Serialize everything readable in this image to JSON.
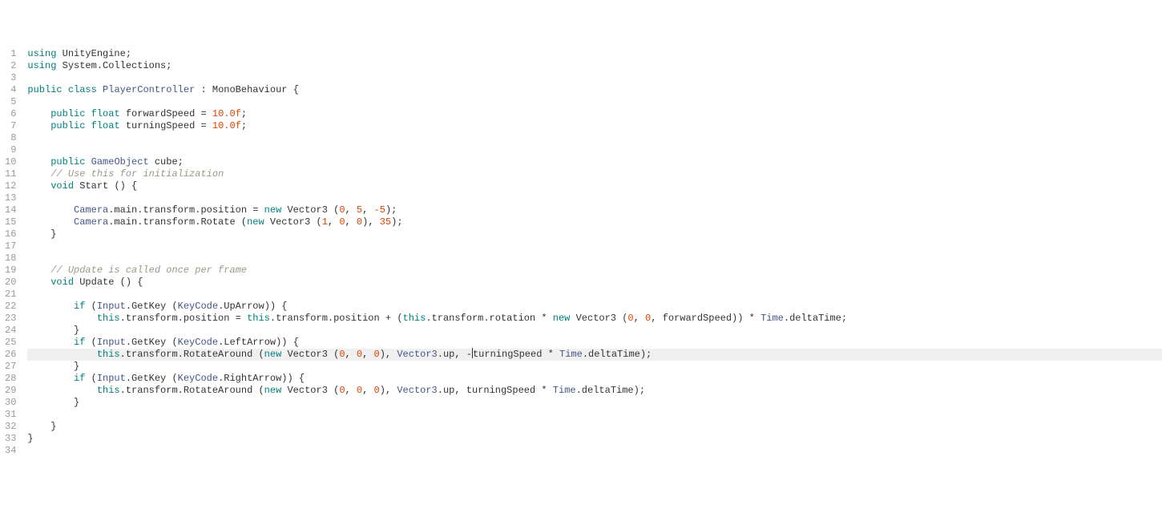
{
  "highlighted_line": 26,
  "lines": [
    {
      "n": 1,
      "tokens": [
        {
          "t": "using",
          "c": "kw"
        },
        {
          "t": " "
        },
        {
          "t": "UnityEngine",
          "c": "ident"
        },
        {
          "t": ";",
          "c": "punct"
        }
      ]
    },
    {
      "n": 2,
      "tokens": [
        {
          "t": "using",
          "c": "kw"
        },
        {
          "t": " "
        },
        {
          "t": "System.Collections",
          "c": "ident"
        },
        {
          "t": ";",
          "c": "punct"
        }
      ]
    },
    {
      "n": 3,
      "tokens": []
    },
    {
      "n": 4,
      "tokens": [
        {
          "t": "public",
          "c": "kw"
        },
        {
          "t": " "
        },
        {
          "t": "class",
          "c": "kw"
        },
        {
          "t": " "
        },
        {
          "t": "PlayerController",
          "c": "classname"
        },
        {
          "t": " : "
        },
        {
          "t": "MonoBehaviour",
          "c": "ident"
        },
        {
          "t": " {",
          "c": "punct"
        }
      ]
    },
    {
      "n": 5,
      "tokens": []
    },
    {
      "n": 6,
      "tokens": [
        {
          "t": "    "
        },
        {
          "t": "public",
          "c": "kw"
        },
        {
          "t": " "
        },
        {
          "t": "float",
          "c": "type"
        },
        {
          "t": " "
        },
        {
          "t": "forwardSpeed",
          "c": "ident"
        },
        {
          "t": " = "
        },
        {
          "t": "10.0f",
          "c": "num"
        },
        {
          "t": ";",
          "c": "punct"
        }
      ]
    },
    {
      "n": 7,
      "tokens": [
        {
          "t": "    "
        },
        {
          "t": "public",
          "c": "kw"
        },
        {
          "t": " "
        },
        {
          "t": "float",
          "c": "type"
        },
        {
          "t": " "
        },
        {
          "t": "turningSpeed",
          "c": "ident"
        },
        {
          "t": " = "
        },
        {
          "t": "10.0f",
          "c": "num"
        },
        {
          "t": ";",
          "c": "punct"
        }
      ]
    },
    {
      "n": 8,
      "tokens": []
    },
    {
      "n": 9,
      "tokens": []
    },
    {
      "n": 10,
      "tokens": [
        {
          "t": "    "
        },
        {
          "t": "public",
          "c": "kw"
        },
        {
          "t": " "
        },
        {
          "t": "GameObject",
          "c": "classname"
        },
        {
          "t": " "
        },
        {
          "t": "cube",
          "c": "ident"
        },
        {
          "t": ";",
          "c": "punct"
        }
      ]
    },
    {
      "n": 11,
      "tokens": [
        {
          "t": "    "
        },
        {
          "t": "// Use this for initialization",
          "c": "comment"
        }
      ]
    },
    {
      "n": 12,
      "tokens": [
        {
          "t": "    "
        },
        {
          "t": "void",
          "c": "type"
        },
        {
          "t": " "
        },
        {
          "t": "Start",
          "c": "ident"
        },
        {
          "t": " () {",
          "c": "punct"
        }
      ]
    },
    {
      "n": 13,
      "tokens": []
    },
    {
      "n": 14,
      "tokens": [
        {
          "t": "        "
        },
        {
          "t": "Camera",
          "c": "classname"
        },
        {
          "t": ".main.transform.position = "
        },
        {
          "t": "new",
          "c": "kw"
        },
        {
          "t": " "
        },
        {
          "t": "Vector3",
          "c": "ident"
        },
        {
          "t": " ("
        },
        {
          "t": "0",
          "c": "num"
        },
        {
          "t": ", "
        },
        {
          "t": "5",
          "c": "num"
        },
        {
          "t": ", "
        },
        {
          "t": "-5",
          "c": "num"
        },
        {
          "t": ");",
          "c": "punct"
        }
      ]
    },
    {
      "n": 15,
      "tokens": [
        {
          "t": "        "
        },
        {
          "t": "Camera",
          "c": "classname"
        },
        {
          "t": ".main.transform.Rotate ("
        },
        {
          "t": "new",
          "c": "kw"
        },
        {
          "t": " "
        },
        {
          "t": "Vector3",
          "c": "ident"
        },
        {
          "t": " ("
        },
        {
          "t": "1",
          "c": "num"
        },
        {
          "t": ", "
        },
        {
          "t": "0",
          "c": "num"
        },
        {
          "t": ", "
        },
        {
          "t": "0",
          "c": "num"
        },
        {
          "t": "), "
        },
        {
          "t": "35",
          "c": "num"
        },
        {
          "t": ");",
          "c": "punct"
        }
      ]
    },
    {
      "n": 16,
      "tokens": [
        {
          "t": "    }",
          "c": "punct"
        }
      ]
    },
    {
      "n": 17,
      "tokens": []
    },
    {
      "n": 18,
      "tokens": []
    },
    {
      "n": 19,
      "tokens": [
        {
          "t": "    "
        },
        {
          "t": "// Update is called once per frame",
          "c": "comment"
        }
      ]
    },
    {
      "n": 20,
      "tokens": [
        {
          "t": "    "
        },
        {
          "t": "void",
          "c": "type"
        },
        {
          "t": " "
        },
        {
          "t": "Update",
          "c": "ident"
        },
        {
          "t": " () {",
          "c": "punct"
        }
      ]
    },
    {
      "n": 21,
      "tokens": []
    },
    {
      "n": 22,
      "tokens": [
        {
          "t": "        "
        },
        {
          "t": "if",
          "c": "kw"
        },
        {
          "t": " ("
        },
        {
          "t": "Input",
          "c": "classname"
        },
        {
          "t": ".GetKey ("
        },
        {
          "t": "KeyCode",
          "c": "classname"
        },
        {
          "t": ".UpArrow)) {",
          "c": "punct"
        }
      ]
    },
    {
      "n": 23,
      "tokens": [
        {
          "t": "            "
        },
        {
          "t": "this",
          "c": "kw"
        },
        {
          "t": ".transform.position = "
        },
        {
          "t": "this",
          "c": "kw"
        },
        {
          "t": ".transform.position + ("
        },
        {
          "t": "this",
          "c": "kw"
        },
        {
          "t": ".transform.rotation * "
        },
        {
          "t": "new",
          "c": "kw"
        },
        {
          "t": " "
        },
        {
          "t": "Vector3",
          "c": "ident"
        },
        {
          "t": " ("
        },
        {
          "t": "0",
          "c": "num"
        },
        {
          "t": ", "
        },
        {
          "t": "0",
          "c": "num"
        },
        {
          "t": ", forwardSpeed)) * "
        },
        {
          "t": "Time",
          "c": "classname"
        },
        {
          "t": ".deltaTime;",
          "c": "punct"
        }
      ]
    },
    {
      "n": 24,
      "tokens": [
        {
          "t": "        }",
          "c": "punct"
        }
      ]
    },
    {
      "n": 25,
      "tokens": [
        {
          "t": "        "
        },
        {
          "t": "if",
          "c": "kw"
        },
        {
          "t": " ("
        },
        {
          "t": "Input",
          "c": "classname"
        },
        {
          "t": ".GetKey ("
        },
        {
          "t": "KeyCode",
          "c": "classname"
        },
        {
          "t": ".LeftArrow)) {",
          "c": "punct"
        }
      ]
    },
    {
      "n": 26,
      "tokens": [
        {
          "t": "            "
        },
        {
          "t": "this",
          "c": "kw"
        },
        {
          "t": ".transform.RotateAround ("
        },
        {
          "t": "new",
          "c": "kw"
        },
        {
          "t": " "
        },
        {
          "t": "Vector3",
          "c": "ident"
        },
        {
          "t": " ("
        },
        {
          "t": "0",
          "c": "num"
        },
        {
          "t": ", "
        },
        {
          "t": "0",
          "c": "num"
        },
        {
          "t": ", "
        },
        {
          "t": "0",
          "c": "num"
        },
        {
          "t": "), "
        },
        {
          "t": "Vector3",
          "c": "classname"
        },
        {
          "t": ".up, -"
        },
        {
          "cursor": true
        },
        {
          "t": "turningSpeed * "
        },
        {
          "t": "Time",
          "c": "classname"
        },
        {
          "t": ".deltaTime);",
          "c": "punct"
        }
      ]
    },
    {
      "n": 27,
      "tokens": [
        {
          "t": "        }",
          "c": "punct"
        }
      ]
    },
    {
      "n": 28,
      "tokens": [
        {
          "t": "        "
        },
        {
          "t": "if",
          "c": "kw"
        },
        {
          "t": " ("
        },
        {
          "t": "Input",
          "c": "classname"
        },
        {
          "t": ".GetKey ("
        },
        {
          "t": "KeyCode",
          "c": "classname"
        },
        {
          "t": ".RightArrow)) {",
          "c": "punct"
        }
      ]
    },
    {
      "n": 29,
      "tokens": [
        {
          "t": "            "
        },
        {
          "t": "this",
          "c": "kw"
        },
        {
          "t": ".transform.RotateAround ("
        },
        {
          "t": "new",
          "c": "kw"
        },
        {
          "t": " "
        },
        {
          "t": "Vector3",
          "c": "ident"
        },
        {
          "t": " ("
        },
        {
          "t": "0",
          "c": "num"
        },
        {
          "t": ", "
        },
        {
          "t": "0",
          "c": "num"
        },
        {
          "t": ", "
        },
        {
          "t": "0",
          "c": "num"
        },
        {
          "t": "), "
        },
        {
          "t": "Vector3",
          "c": "classname"
        },
        {
          "t": ".up, turningSpeed * "
        },
        {
          "t": "Time",
          "c": "classname"
        },
        {
          "t": ".deltaTime);",
          "c": "punct"
        }
      ]
    },
    {
      "n": 30,
      "tokens": [
        {
          "t": "        }",
          "c": "punct"
        }
      ]
    },
    {
      "n": 31,
      "tokens": []
    },
    {
      "n": 32,
      "tokens": [
        {
          "t": "    }",
          "c": "punct"
        }
      ]
    },
    {
      "n": 33,
      "tokens": [
        {
          "t": "}",
          "c": "punct"
        }
      ]
    },
    {
      "n": 34,
      "tokens": []
    }
  ]
}
